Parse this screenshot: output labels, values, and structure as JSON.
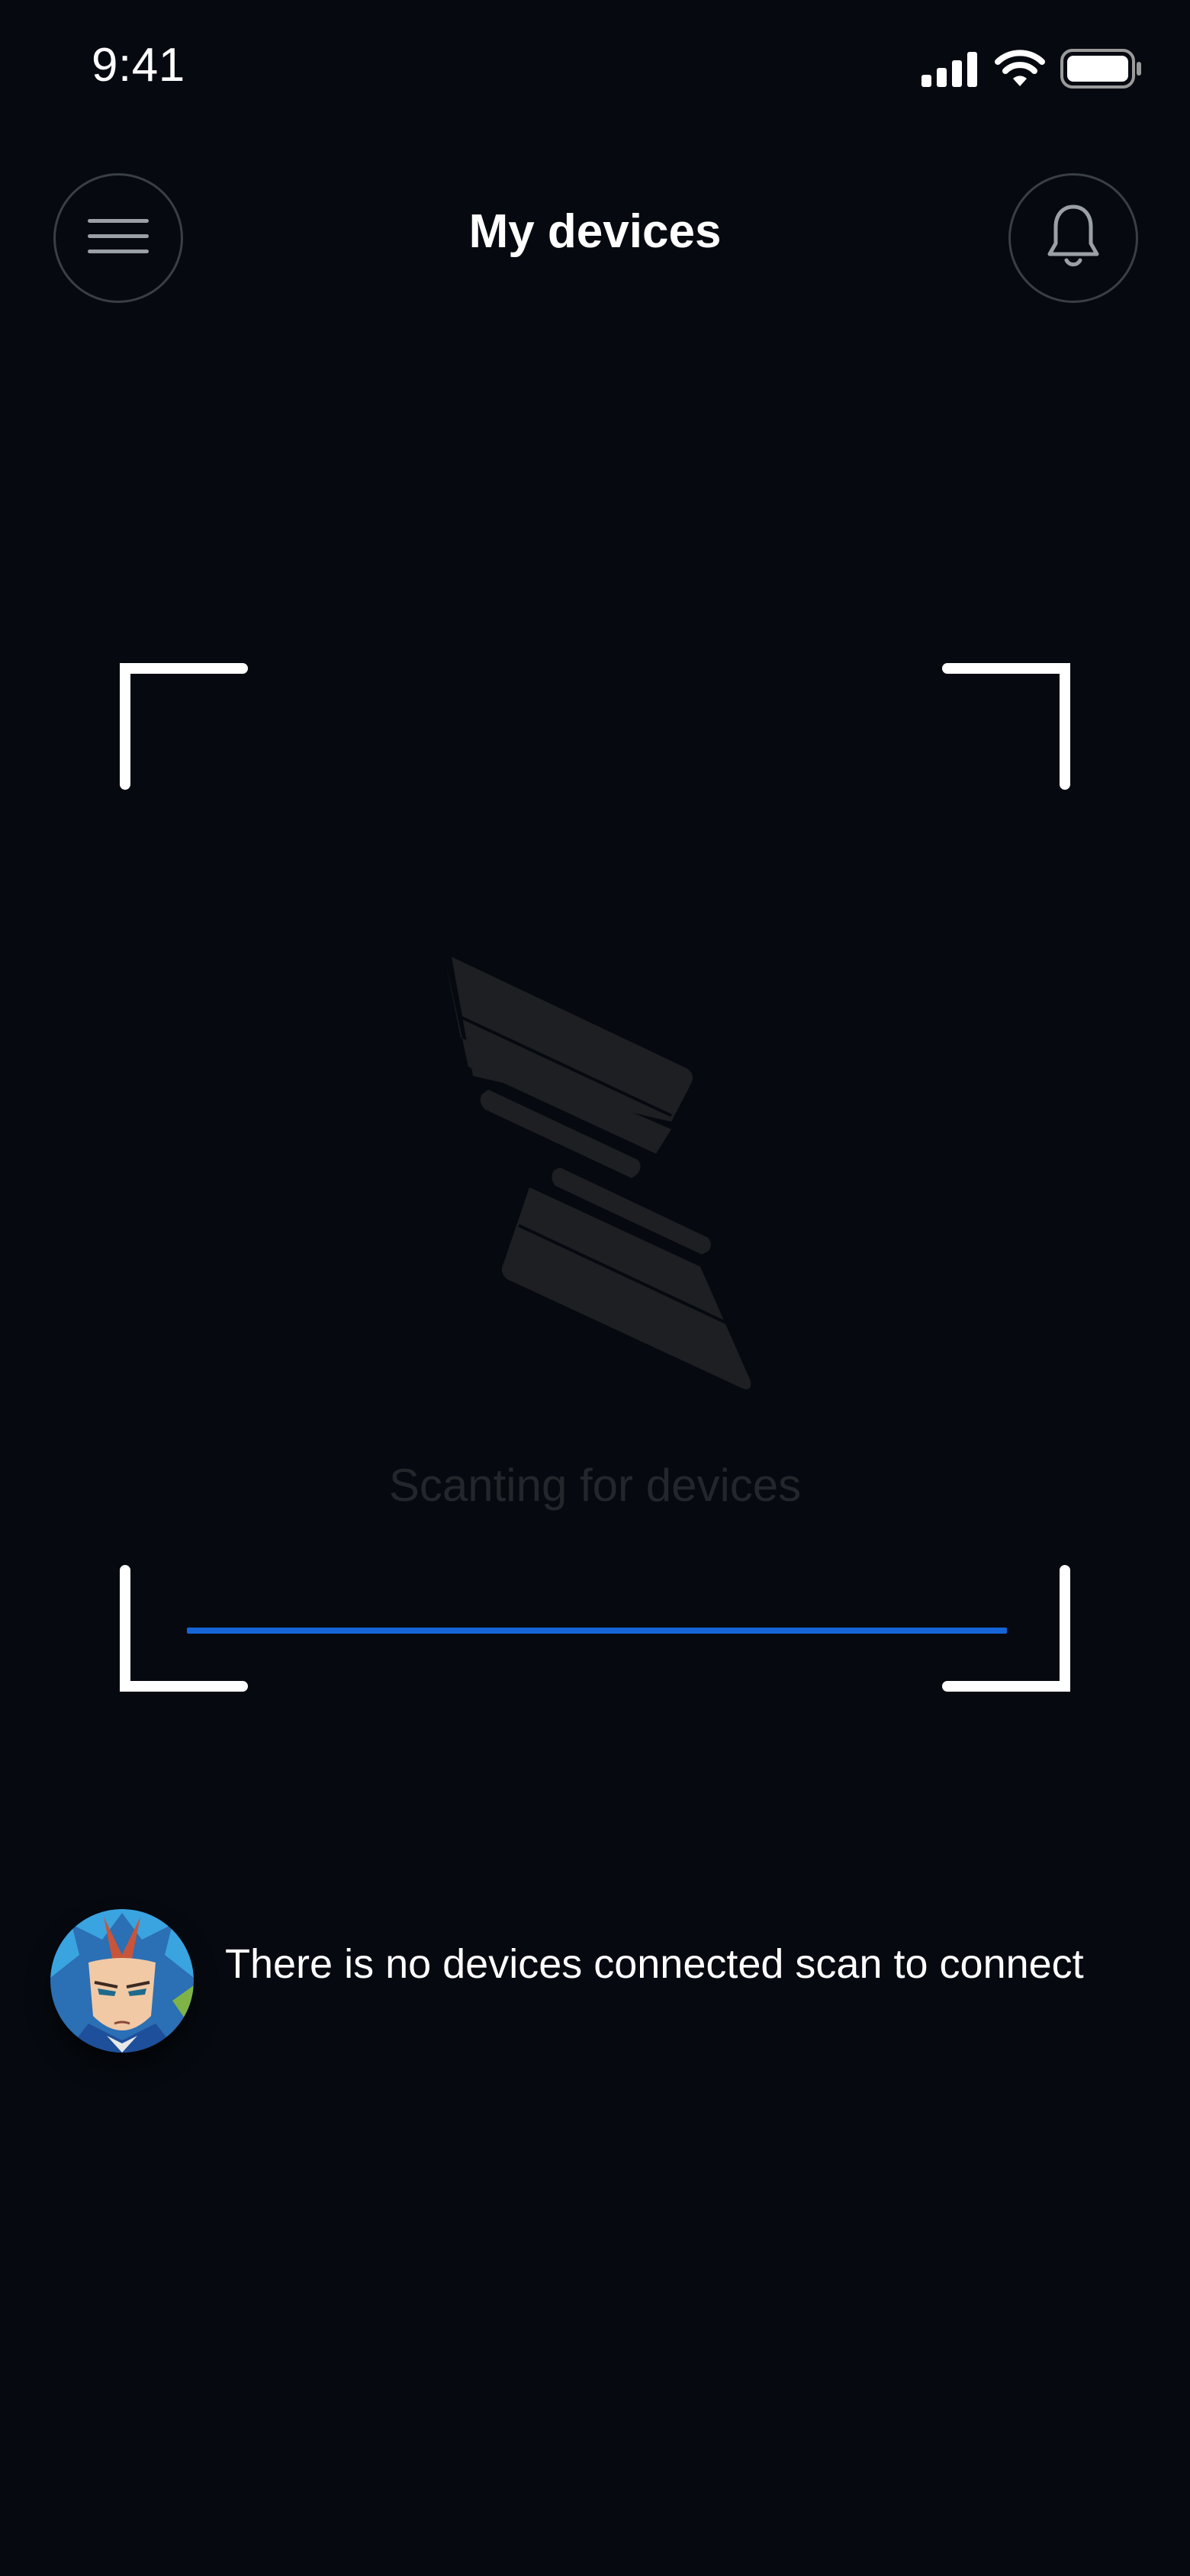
{
  "status_bar": {
    "time": "9:41",
    "icons": [
      "signal-icon",
      "wifi-icon",
      "battery-icon"
    ]
  },
  "header": {
    "title": "My devices",
    "menu_icon": "hamburger-menu-icon",
    "notification_icon": "bell-icon"
  },
  "scanner": {
    "status_text": "Scanting for devices",
    "logo_icon": "brand-logo-icon",
    "scan_line_color": "#1565d8"
  },
  "message": {
    "text": "There is no devices connected scan to connect",
    "avatar": "user-avatar"
  },
  "colors": {
    "background": "#060a10",
    "accent": "#1565d8",
    "frame": "#ffffff"
  }
}
